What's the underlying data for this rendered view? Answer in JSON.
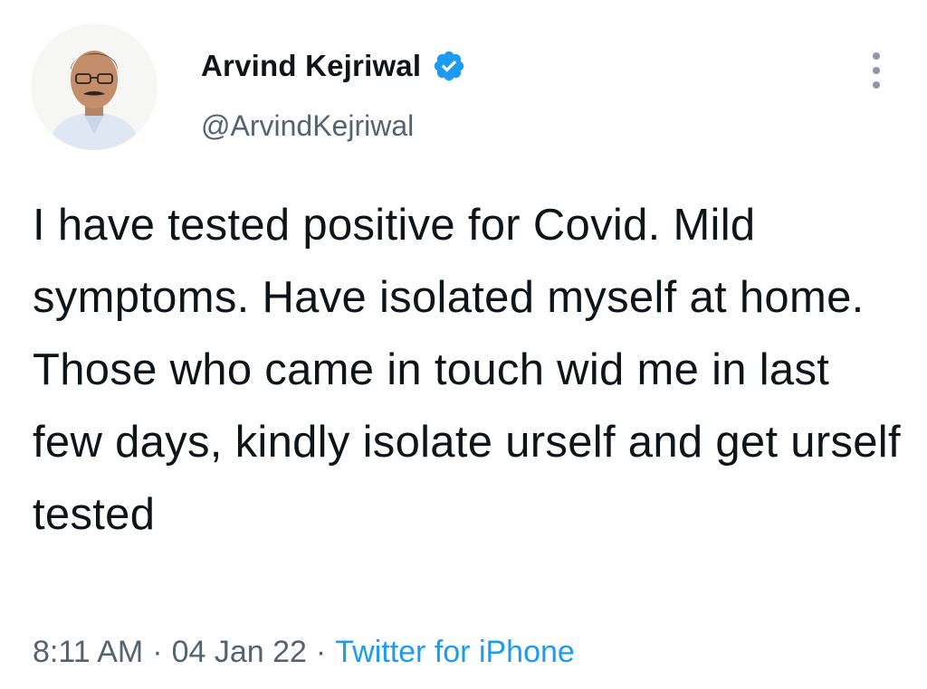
{
  "author": {
    "display_name": "Arvind Kejriwal",
    "handle": "@ArvindKejriwal",
    "verified": true,
    "avatar_icon": "profile-photo",
    "verified_icon": "verified-badge-icon"
  },
  "tweet": {
    "text": "I have tested positive for Covid. Mild symptoms. Have isolated myself at home. Those who came in touch wid me in last few days, kindly isolate urself and get urself tested"
  },
  "meta": {
    "time": "8:11 AM",
    "separator": "·",
    "date": "04 Jan 22",
    "source": "Twitter for iPhone"
  },
  "colors": {
    "text": "#0f1419",
    "secondary": "#536471",
    "accent": "#1d9bf0"
  },
  "menu": {
    "icon": "more-vertical-icon"
  }
}
